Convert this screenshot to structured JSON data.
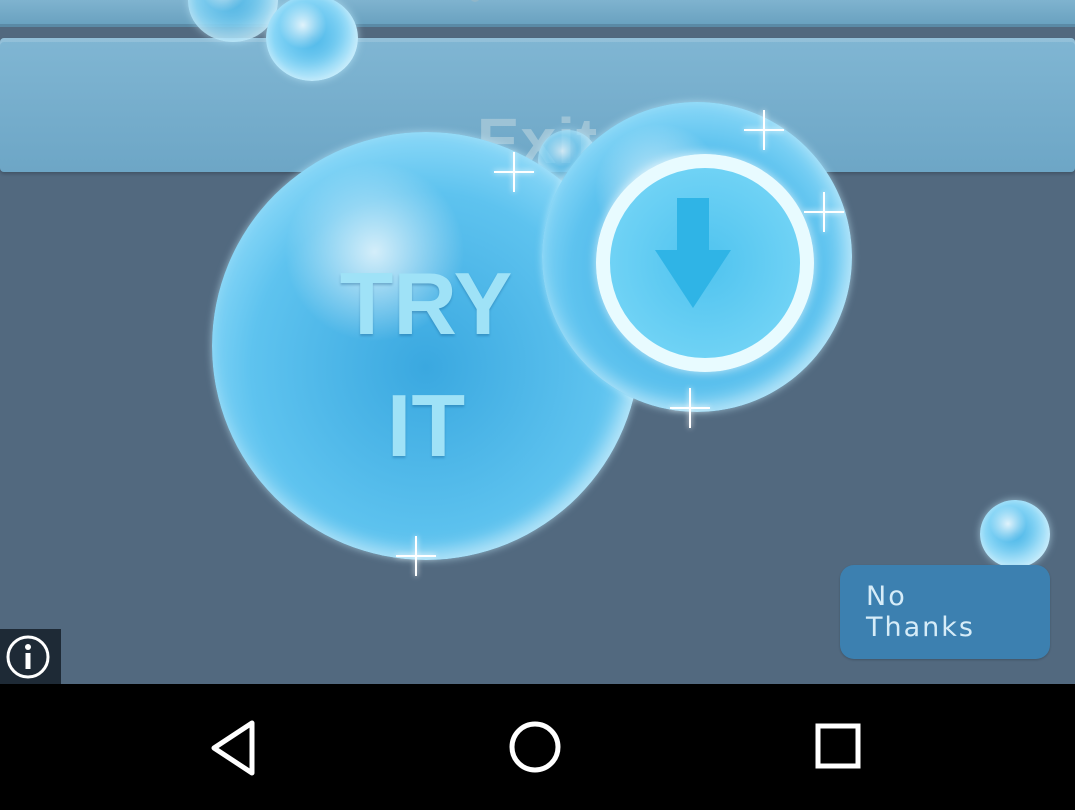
{
  "ad": {
    "exit_label": "Exit",
    "try_line1": "TRY",
    "try_line2": "IT",
    "no_thanks_label": "No\nThanks"
  },
  "icons": {
    "download": "download-arrow-icon",
    "info": "info-icon",
    "back": "back-triangle-icon",
    "home": "home-circle-icon",
    "recents": "recents-square-icon"
  },
  "colors": {
    "background": "#52697f",
    "exit_bar": "#80b6d3",
    "no_thanks": "#3c80b0",
    "bubble": "#5ec3ef"
  }
}
